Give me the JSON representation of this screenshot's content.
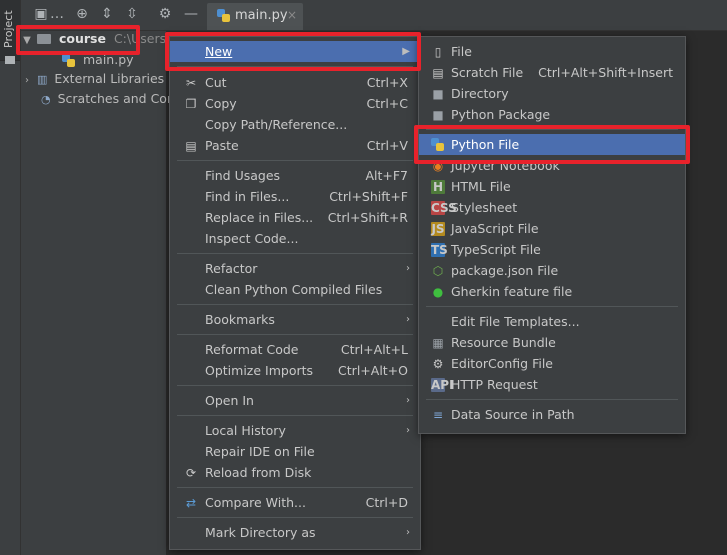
{
  "sidebar": {
    "project_tab": "Project"
  },
  "editor": {
    "tab_label": "main.py",
    "tab_close": "×"
  },
  "tree": {
    "root_name": "course",
    "root_path": "C:\\Users\\",
    "main_file": "main.py",
    "external_libraries": "External Libraries",
    "scratches": "Scratches and Con"
  },
  "context_menu": {
    "new": "New",
    "cut": "Cut",
    "cut_sc": "Ctrl+X",
    "copy": "Copy",
    "copy_sc": "Ctrl+C",
    "copy_path": "Copy Path/Reference...",
    "paste": "Paste",
    "paste_sc": "Ctrl+V",
    "find_usages": "Find Usages",
    "find_usages_sc": "Alt+F7",
    "find_in_files": "Find in Files...",
    "find_in_files_sc": "Ctrl+Shift+F",
    "replace_in_files": "Replace in Files...",
    "replace_in_files_sc": "Ctrl+Shift+R",
    "inspect_code": "Inspect Code...",
    "refactor": "Refactor",
    "clean_compiled": "Clean Python Compiled Files",
    "bookmarks": "Bookmarks",
    "reformat_code": "Reformat Code",
    "reformat_code_sc": "Ctrl+Alt+L",
    "optimize_imports": "Optimize Imports",
    "optimize_imports_sc": "Ctrl+Alt+O",
    "open_in": "Open In",
    "local_history": "Local History",
    "repair_ide": "Repair IDE on File",
    "reload_disk": "Reload from Disk",
    "compare_with": "Compare With...",
    "compare_with_sc": "Ctrl+D",
    "mark_directory": "Mark Directory as"
  },
  "new_submenu": {
    "file": "File",
    "scratch_file": "Scratch File",
    "scratch_file_sc": "Ctrl+Alt+Shift+Insert",
    "directory": "Directory",
    "python_package": "Python Package",
    "python_file": "Python File",
    "jupyter_notebook": "Jupyter Notebook",
    "html_file": "HTML File",
    "stylesheet": "Stylesheet",
    "javascript_file": "JavaScript File",
    "typescript_file": "TypeScript File",
    "package_json": "package.json File",
    "gherkin": "Gherkin feature file",
    "edit_templates": "Edit File Templates...",
    "resource_bundle": "Resource Bundle",
    "editorconfig": "EditorConfig File",
    "http_request": "HTTP Request",
    "data_source": "Data Source in Path"
  },
  "colors": {
    "selection": "#4b6eaf",
    "highlight_box": "#e8222b",
    "menu_bg": "#3c3f41"
  }
}
